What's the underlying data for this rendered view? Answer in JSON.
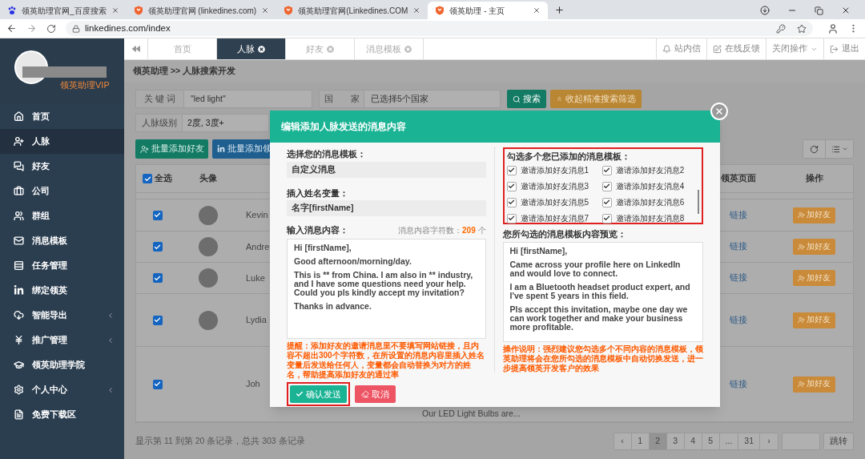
{
  "browser": {
    "tabs": [
      {
        "title": "领英助理官网_百度搜索",
        "kind": "baidu",
        "selected": false
      },
      {
        "title": "领英助理官网 (linkedines.com)",
        "kind": "site",
        "selected": false
      },
      {
        "title": "领英助理官网(Linkedines.COM",
        "kind": "site",
        "selected": false
      },
      {
        "title": "领英助理 - 主页",
        "kind": "site",
        "selected": true
      }
    ],
    "url": "linkedines.com/index"
  },
  "sidebar": {
    "user_badge": "领英助理VIP",
    "items": [
      {
        "label": "首页",
        "kind": "home",
        "selected": false,
        "expandable": false
      },
      {
        "label": "人脉",
        "kind": "user-plus",
        "selected": true,
        "expandable": false
      },
      {
        "label": "好友",
        "kind": "chat",
        "selected": false,
        "expandable": false
      },
      {
        "label": "公司",
        "kind": "briefcase",
        "selected": false,
        "expandable": false
      },
      {
        "label": "群组",
        "kind": "users",
        "selected": false,
        "expandable": false
      },
      {
        "label": "消息模板",
        "kind": "mail",
        "selected": false,
        "expandable": false
      },
      {
        "label": "任务管理",
        "kind": "tasks",
        "selected": false,
        "expandable": false
      },
      {
        "label": "绑定领英",
        "kind": "linkedin",
        "selected": false,
        "expandable": false
      },
      {
        "label": "智能导出",
        "kind": "cloud",
        "selected": false,
        "expandable": true
      },
      {
        "label": "推广管理",
        "kind": "yen",
        "selected": false,
        "expandable": true
      },
      {
        "label": "领英助理学院",
        "kind": "graduation",
        "selected": false,
        "expandable": false
      },
      {
        "label": "个人中心",
        "kind": "gear",
        "selected": false,
        "expandable": true
      },
      {
        "label": "免费下载区",
        "kind": "file",
        "selected": false,
        "expandable": false
      }
    ]
  },
  "top_nav": {
    "tabs": [
      {
        "label": "首页",
        "selected": false,
        "closable": false
      },
      {
        "label": "人脉",
        "selected": true,
        "closable": true
      },
      {
        "label": "好友",
        "selected": false,
        "closable": true
      },
      {
        "label": "消息模板",
        "selected": false,
        "closable": true
      }
    ],
    "actions": [
      {
        "label": "站内信",
        "kind": "bell"
      },
      {
        "label": "在线反馈",
        "kind": "edit"
      },
      {
        "label": "关闭操作",
        "kind": "dropdown"
      },
      {
        "label": "退出",
        "kind": "logout"
      }
    ]
  },
  "breadcrumb": "领英助理 >> 人脉搜索开发",
  "filters": [
    {
      "label": "关 键 词",
      "value": "\"led light\""
    },
    {
      "label": "国　　家",
      "value": "已选择5个国家"
    },
    {
      "label": "人脉级别",
      "value": "2度, 3度+"
    }
  ],
  "search_buttons": [
    {
      "label": "搜索",
      "kind": "search"
    },
    {
      "label": "收起精准搜索筛选",
      "kind": "collapse"
    }
  ],
  "bulk_buttons": [
    {
      "label": "批量添加好友",
      "kind": "add-friend"
    },
    {
      "label": "批量添加领",
      "kind": "linkedin"
    }
  ],
  "table": {
    "select_all": {
      "label": "全选",
      "checked": true
    },
    "columns": [
      "头像",
      "领英页面",
      "操作"
    ],
    "rows": [
      {
        "checked": true,
        "avatar": true,
        "name": "Kevin",
        "link": "链接",
        "action": "加好友"
      },
      {
        "checked": true,
        "avatar": true,
        "name": "Andre",
        "link": "链接",
        "action": "加好友"
      },
      {
        "checked": true,
        "avatar": true,
        "name": "Luke",
        "link": "链接",
        "action": "加好友"
      },
      {
        "checked": true,
        "avatar": true,
        "name": "Lydia",
        "link": "链接",
        "action": "加好友"
      },
      {
        "checked": true,
        "avatar": false,
        "name": "Joh",
        "snippet": "Our LED Light Bulbs are...",
        "link": "链接",
        "action": "加好友"
      }
    ]
  },
  "pagination": {
    "summary": "显示第 11 到第 20 条记录，总共 303 条记录",
    "pages": [
      {
        "label": "‹",
        "selected": false
      },
      {
        "label": "1",
        "selected": false
      },
      {
        "label": "2",
        "selected": true
      },
      {
        "label": "3",
        "selected": false
      },
      {
        "label": "4",
        "selected": false
      },
      {
        "label": "5",
        "selected": false
      },
      {
        "label": "...",
        "selected": false
      },
      {
        "label": "31",
        "selected": false
      },
      {
        "label": "›",
        "selected": false
      }
    ],
    "jump": "跳转"
  },
  "modal": {
    "title": "编辑添加人脉发送的消息内容",
    "template_label": "选择您的消息模板：",
    "template_value": "自定义消息",
    "name_var_label": "插入姓名变量：",
    "name_var_value": "名字[firstName]",
    "content_label": "输入消息内容：",
    "count_label": "消息内容字符数：",
    "count": "209",
    "count_unit": "个",
    "message": [
      "Hi [firstName],",
      "Good afternoon/morning/day.",
      "This is ** from China. I am also in ** industry, and I have some questions need your help. Could you pls kindly accept my invitation?",
      "Thanks in advance."
    ],
    "warning": "提醒：添加好友的邀请消息里不要填写网站链接，且内容不超出300个字符数，在所设置的消息内容里插入姓名变量后发送给任何人，变量都会自动替换为对方的姓名，帮助提高添加好友的通过率",
    "confirm": {
      "label": "确认发送",
      "highlighted": true
    },
    "cancel": "取消",
    "templates_label": "勾选多个您已添加的消息模板：",
    "templates_highlighted": true,
    "templates": [
      {
        "label": "邀请添加好友消息1",
        "checked": true
      },
      {
        "label": "邀请添加好友消息2",
        "checked": true
      },
      {
        "label": "邀请添加好友消息3",
        "checked": true
      },
      {
        "label": "邀请添加好友消息4",
        "checked": true
      },
      {
        "label": "邀请添加好友消息5",
        "checked": true
      },
      {
        "label": "邀请添加好友消息6",
        "checked": true
      },
      {
        "label": "邀请添加好友消息7",
        "checked": true
      },
      {
        "label": "邀请添加好友消息8",
        "checked": true
      }
    ],
    "preview_label": "您所勾选的消息模板内容预览：",
    "preview": [
      "Hi [firstName],",
      "Came across your profile here on LinkedIn and would love to connect.",
      "I am a Bluetooth headset product expert, and I've spent 5 years in this field.",
      "Pls accept this invitation, maybe one day we can work together and make your business more profitable."
    ],
    "note": "操作说明：强烈建议您勾选多个不同内容的消息模板，领英助理将会在您所勾选的消息模板中自动切换发送，进一步提高领英开发客户的效果"
  }
}
